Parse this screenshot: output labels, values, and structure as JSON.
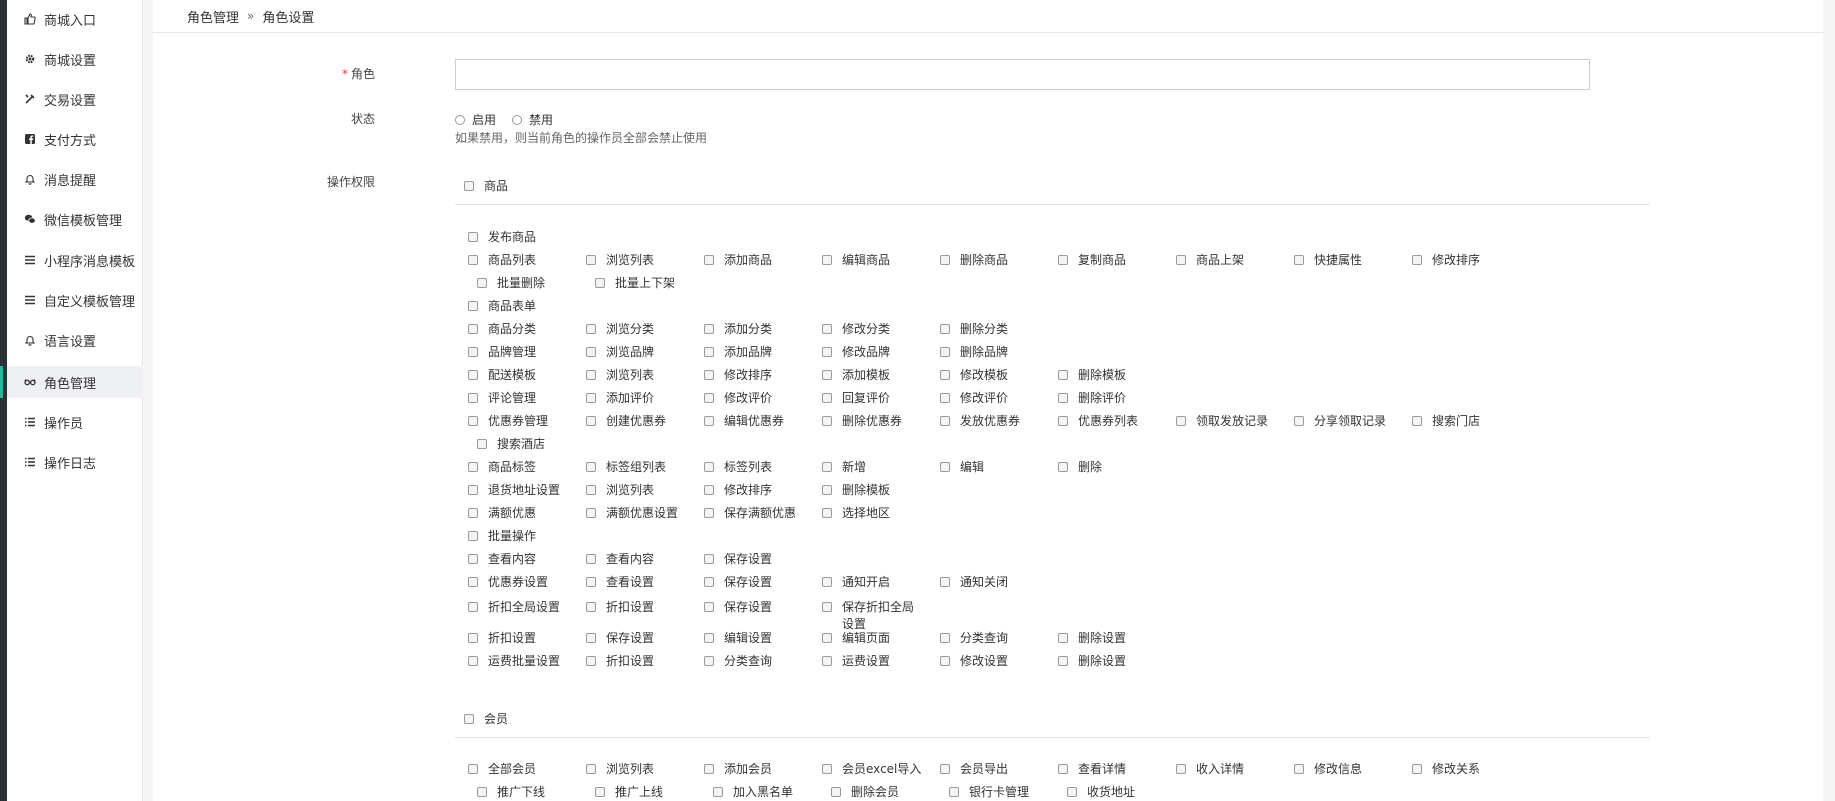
{
  "sidebar": {
    "items": [
      {
        "name": "sidebar-item-mall-entry",
        "icon_name": "thumbs-up-icon",
        "label": "商城入口"
      },
      {
        "name": "sidebar-item-mall-settings",
        "icon_name": "gear-icon",
        "label": "商城设置"
      },
      {
        "name": "sidebar-item-trade-settings",
        "icon_name": "tools-icon",
        "label": "交易设置"
      },
      {
        "name": "sidebar-item-payment",
        "icon_name": "facebook-square-icon",
        "label": "支付方式"
      },
      {
        "name": "sidebar-item-notifications",
        "icon_name": "bell-icon",
        "label": "消息提醒"
      },
      {
        "name": "sidebar-item-wechat-template",
        "icon_name": "wechat-icon",
        "label": "微信模板管理"
      },
      {
        "name": "sidebar-item-miniprogram-message",
        "icon_name": "menu-icon",
        "label": "小程序消息模板"
      },
      {
        "name": "sidebar-item-custom-template",
        "icon_name": "menu-icon",
        "label": "自定义模板管理"
      },
      {
        "name": "sidebar-item-language",
        "icon_name": "bell-icon",
        "label": "语言设置"
      },
      {
        "name": "sidebar-item-role",
        "icon_name": "glasses-icon",
        "label": "角色管理",
        "active": true
      },
      {
        "name": "sidebar-item-operator",
        "icon_name": "list-icon",
        "label": "操作员"
      },
      {
        "name": "sidebar-item-operation-log",
        "icon_name": "list-icon",
        "label": "操作日志"
      }
    ]
  },
  "breadcrumb": {
    "parent": "角色管理",
    "separator": "»",
    "current": "角色设置"
  },
  "form": {
    "role_required_mark": "*",
    "role_label": "角色",
    "role_value": "",
    "status_label": "状态",
    "status_options": [
      "启用",
      "禁用"
    ],
    "status_help": "如果禁用，则当前角色的操作员全部会禁止使用",
    "permissions_label": "操作权限"
  },
  "groups": {
    "goods": {
      "title": "商品",
      "rows": [
        [
          "发布商品"
        ],
        [
          "商品列表",
          "浏览列表",
          "添加商品",
          "编辑商品",
          "删除商品",
          "复制商品",
          "商品上架",
          "快捷属性",
          "修改排序"
        ],
        [
          "批量删除",
          "批量上下架"
        ],
        [
          "商品表单"
        ],
        [
          "商品分类",
          "浏览分类",
          "添加分类",
          "修改分类",
          "删除分类"
        ],
        [
          "品牌管理",
          "浏览品牌",
          "添加品牌",
          "修改品牌",
          "删除品牌"
        ],
        [
          "配送模板",
          "浏览列表",
          "修改排序",
          "添加模板",
          "修改模板",
          "删除模板"
        ],
        [
          "评论管理",
          "添加评价",
          "修改评价",
          "回复评价",
          "修改评价",
          "删除评价"
        ],
        [
          "优惠券管理",
          "创建优惠券",
          "编辑优惠券",
          "删除优惠券",
          "发放优惠券",
          "优惠券列表",
          "领取发放记录",
          "分享领取记录",
          "搜索门店"
        ],
        [
          "搜索酒店"
        ],
        [
          "商品标签",
          "标签组列表",
          "标签列表",
          "新增",
          "编辑",
          "删除"
        ],
        [
          "退货地址设置",
          "浏览列表",
          "修改排序",
          "删除模板"
        ],
        [
          "满额优惠",
          "满额优惠设置",
          "保存满额优惠",
          "选择地区"
        ],
        [
          "批量操作"
        ],
        [
          "查看内容",
          "查看内容",
          "保存设置"
        ],
        [
          "优惠券设置",
          "查看设置",
          "保存设置",
          "通知开启",
          "通知关闭"
        ],
        [
          "折扣全局设置",
          "折扣设置",
          "保存设置",
          "保存折扣全局设置"
        ],
        [
          "折扣设置",
          "保存设置",
          "编辑设置",
          "编辑页面",
          "分类查询",
          "删除设置"
        ],
        [
          "运费批量设置",
          "折扣设置",
          "分类查询",
          "运费设置",
          "修改设置",
          "删除设置"
        ]
      ]
    },
    "member": {
      "title": "会员",
      "rows": [
        [
          "全部会员",
          "浏览列表",
          "添加会员",
          "会员excel导入",
          "会员导出",
          "查看详情",
          "收入详情",
          "修改信息",
          "修改关系"
        ],
        [
          "推广下线",
          "推广上线",
          "加入黑名单",
          "删除会员",
          "银行卡管理",
          "收货地址"
        ]
      ]
    }
  },
  "colors": {
    "accent": "#1bbc9b",
    "rail": "#2b3138",
    "active_bg": "#eef0f3"
  }
}
